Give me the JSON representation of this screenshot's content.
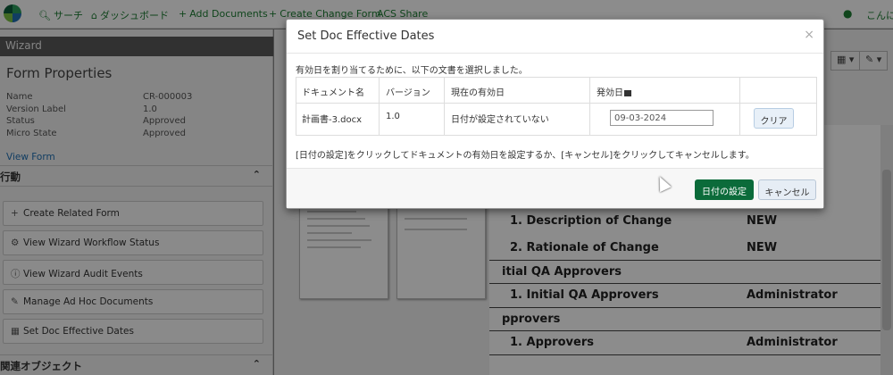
{
  "nav": {
    "search": "サーチ",
    "dashboard": "ダッシュボード",
    "add_documents": "Add Documents",
    "create_change_form": "Create Change Form",
    "acs_share": "ACS Share",
    "user": "こんに"
  },
  "sidebar": {
    "wizard": "Wizard",
    "form_properties": "Form Properties",
    "props": [
      {
        "k": "Name",
        "v": "CR-000003"
      },
      {
        "k": "Version Label",
        "v": "1.0"
      },
      {
        "k": "Status",
        "v": "Approved"
      },
      {
        "k": "Micro State",
        "v": "Approved"
      }
    ],
    "view_form": "View Form",
    "actions_header": "行動",
    "actions": [
      {
        "label": "Create Related Form",
        "icon": "plus-icon"
      },
      {
        "label": "View Wizard Workflow Status",
        "icon": "gear-icon"
      },
      {
        "label": "View Wizard Audit Events",
        "icon": "info-icon"
      },
      {
        "label": "Manage Ad Hoc Documents",
        "icon": "document-edit-icon"
      },
      {
        "label": "Set Doc Effective Dates",
        "icon": "calendar-icon"
      }
    ],
    "related_objects_header": "関連オブジェクト"
  },
  "document": {
    "rows": [
      {
        "label": "1. Description of Change",
        "value": "NEW"
      },
      {
        "label": "2. Rationale of Change",
        "value": "NEW"
      },
      {
        "label": "itial QA Approvers",
        "value": ""
      },
      {
        "label": "1. Initial QA Approvers",
        "value": "Administrator"
      },
      {
        "label": "pprovers",
        "value": ""
      },
      {
        "label": "1. Approvers",
        "value": "Administrator"
      }
    ]
  },
  "modal": {
    "title": "Set Doc Effective Dates",
    "intro": "有効日を割り当てるために、以下の文書を選択しました。",
    "columns": {
      "doc_name": "ドキュメント名",
      "version": "バージョン",
      "current": "現在の有効日",
      "effective": "発効日"
    },
    "row": {
      "doc_name": "計画書-3.docx",
      "version": "1.0",
      "current": "日付が設定されていない",
      "date_value": "09-03-2024",
      "clear_label": "クリア"
    },
    "note": "[日付の設定]をクリックしてドキュメントの有効日を設定するか、[キャンセル]をクリックしてキャンセルします。",
    "set_button": "日付の設定",
    "cancel_button": "キャンセル"
  },
  "colors": {
    "brand_green": "#0b6b3a",
    "link_blue": "#1f6fb2"
  }
}
